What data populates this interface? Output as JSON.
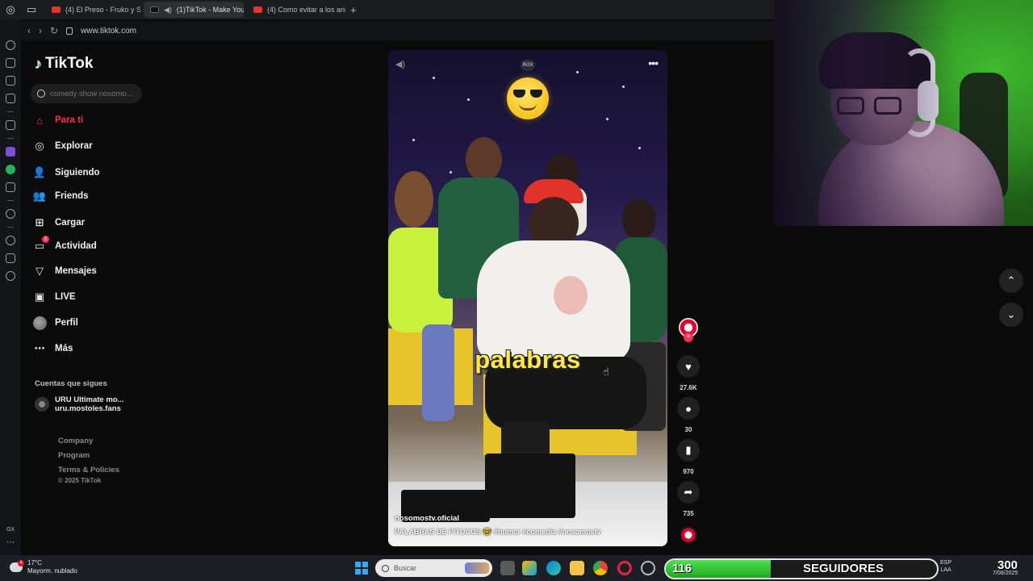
{
  "browser": {
    "tabs": [
      {
        "label": "(4) El Preso - Fruko y Sus",
        "active": false
      },
      {
        "label": "(1)TikTok - Make You",
        "active": true
      },
      {
        "label": "(4) Como evitar a los anim",
        "active": false
      }
    ],
    "new_tab": "+",
    "url": "www.tiktok.com"
  },
  "tiktok": {
    "logo": "TikTok",
    "search_placeholder": "comedy show nosomo...",
    "menu": [
      {
        "label": "Para ti",
        "icon": "home-icon"
      },
      {
        "label": "Explorar",
        "icon": "compass-icon"
      },
      {
        "label": "Siguiendo",
        "icon": "following-icon"
      },
      {
        "label": "Friends",
        "icon": "friends-icon"
      },
      {
        "label": "Cargar",
        "icon": "upload-icon"
      },
      {
        "label": "Actividad",
        "icon": "activity-icon",
        "badge": "1"
      },
      {
        "label": "Mensajes",
        "icon": "messages-icon"
      },
      {
        "label": "LIVE",
        "icon": "live-icon"
      },
      {
        "label": "Perfil",
        "icon": "profile-avatar"
      },
      {
        "label": "Más",
        "icon": "more-icon"
      }
    ],
    "following_title": "Cuentas que sigues",
    "following": [
      {
        "name": "URU Ultimate mo...",
        "handle": "uru.mostoles.fans"
      }
    ],
    "footer": [
      "Company",
      "Program",
      "Terms & Policies"
    ],
    "copyright": "© 2025 TikTok",
    "accent": "#fe2c55"
  },
  "video": {
    "badge": "RGX",
    "caption_word": "palabras",
    "author": "nosomostv.oficial",
    "description": "PALABRAS DE PITUCOS 🤓 #humor #comedia #nosomostv",
    "likes": "27.6K",
    "comments": "30",
    "saves": "970",
    "shares": "735"
  },
  "taskbar": {
    "weather_temp": "17°C",
    "weather_desc": "Mayorm. nublado",
    "weather_badge": "4",
    "search_placeholder": "Buscar",
    "language": "ESP",
    "language_sub": "LAA",
    "date": "7/08/2025"
  },
  "overlay": {
    "subs_current": "116",
    "subs_label": "SEGUIDORES",
    "subs_goal": "300",
    "subs_progress": 0.387,
    "bar_color": "#2fc42f"
  }
}
